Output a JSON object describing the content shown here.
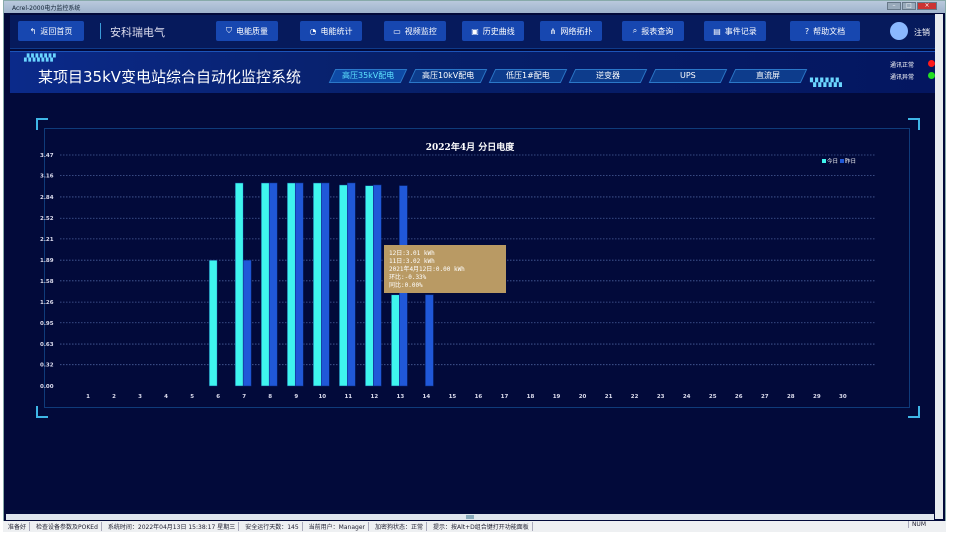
{
  "window": {
    "title": "Acrel-2000电力监控系统",
    "controls": [
      "–",
      "□",
      "×"
    ]
  },
  "nav": {
    "back": "返回首页",
    "brand": "安科瑞电气",
    "items": [
      {
        "label": "电能质量",
        "icon": "shield-icon",
        "glyph": "⛉"
      },
      {
        "label": "电能统计",
        "icon": "pie-chart-icon",
        "glyph": "◔"
      },
      {
        "label": "视频监控",
        "icon": "video-icon",
        "glyph": "▭"
      },
      {
        "label": "历史曲线",
        "icon": "curve-icon",
        "glyph": "▣"
      },
      {
        "label": "网络拓扑",
        "icon": "topology-icon",
        "glyph": "⋔"
      },
      {
        "label": "报表查询",
        "icon": "search-icon",
        "glyph": "⌕"
      },
      {
        "label": "事件记录",
        "icon": "document-icon",
        "glyph": "▤"
      },
      {
        "label": "帮助文档",
        "icon": "help-icon",
        "glyph": "?"
      }
    ],
    "logout": "注销"
  },
  "header": {
    "title": "某项目35kV变电站综合自动化监控系统",
    "tabs": [
      "高压35kV配电",
      "高压10kV配电",
      "低压1#配电",
      "逆变器",
      "UPS",
      "直流屏"
    ],
    "active_tab": 0,
    "comm_ok": "通讯正常",
    "comm_err": "通讯异常",
    "comm_ok_color": "#ff1a1a",
    "comm_err_color": "#22e022"
  },
  "chart_data": {
    "type": "bar",
    "title": "2022年4月  分日电度",
    "ylim": [
      0,
      3.47
    ],
    "grid": true,
    "legend": "top-right",
    "yticks": [
      "0.00",
      "0.32",
      "0.63",
      "0.95",
      "1.26",
      "1.58",
      "1.89",
      "2.21",
      "2.52",
      "2.84",
      "3.16",
      "3.47"
    ],
    "categories": [
      "1",
      "2",
      "3",
      "4",
      "5",
      "6",
      "7",
      "8",
      "9",
      "10",
      "11",
      "12",
      "13",
      "14",
      "15",
      "16",
      "17",
      "18",
      "19",
      "20",
      "21",
      "22",
      "23",
      "24",
      "25",
      "26",
      "27",
      "28",
      "29",
      "30"
    ],
    "series": [
      {
        "name": "今日",
        "color": "#3ff5ee",
        "values": [
          0,
          0,
          0,
          0,
          0,
          1.89,
          3.05,
          3.05,
          3.05,
          3.05,
          3.02,
          3.01,
          1.37,
          0,
          0,
          0,
          0,
          0,
          0,
          0,
          0,
          0,
          0,
          0,
          0,
          0,
          0,
          0,
          0,
          0
        ]
      },
      {
        "name": "昨日",
        "color": "#2058d8",
        "values": [
          0,
          0,
          0,
          0,
          0,
          0,
          1.89,
          3.05,
          3.05,
          3.05,
          3.05,
          3.02,
          3.01,
          1.37,
          0,
          0,
          0,
          0,
          0,
          0,
          0,
          0,
          0,
          0,
          0,
          0,
          0,
          0,
          0,
          0
        ]
      }
    ]
  },
  "tooltip": [
    "12日:3.01 kWh",
    "11日:3.02 kWh",
    "2021年4月12日:0.00 kWh",
    "环比:-0.33%",
    "同比:0.00%"
  ],
  "status": {
    "items": [
      "准备好",
      "检查设备参数及POKEd",
      "系统时间：2022年04月13日  15:38:17  星期三",
      "安全运行天数：145",
      "当前用户：Manager",
      "加密狗状态：正常",
      "提示：按Alt+D组合键打开功能面板"
    ],
    "num": "NUM"
  }
}
